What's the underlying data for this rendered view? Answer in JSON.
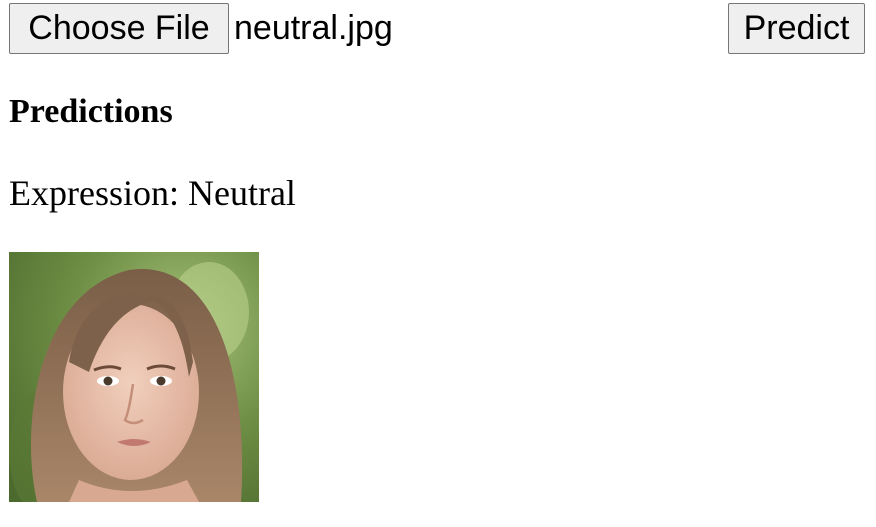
{
  "upload": {
    "choose_file_label": "Choose File",
    "file_name": "neutral.jpg",
    "predict_label": "Predict"
  },
  "results": {
    "heading": "Predictions",
    "expression_label": "Expression:",
    "expression_value": "Neutral"
  },
  "image": {
    "description_icon": "face-photo",
    "background_color": "#6e8f45",
    "hair_color": "#8a6a4e",
    "skin_color": "#e9c2ae"
  }
}
